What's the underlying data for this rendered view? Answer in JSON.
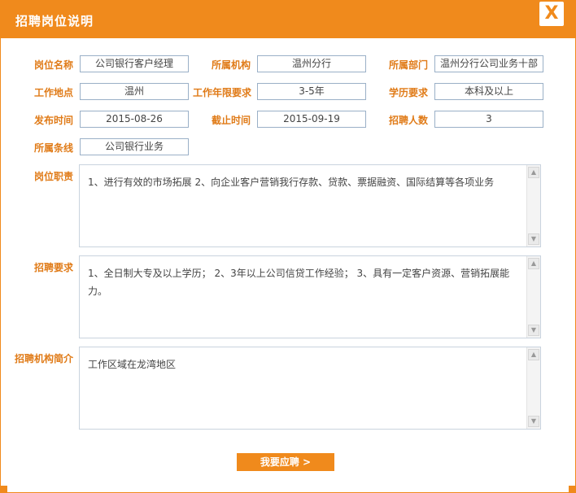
{
  "dialog": {
    "title": "招聘岗位说明",
    "close_label": "X"
  },
  "fields": {
    "post_name": {
      "label": "岗位名称",
      "value": "公司银行客户经理"
    },
    "org": {
      "label": "所属机构",
      "value": "温州分行"
    },
    "dept": {
      "label": "所属部门",
      "value": "温州分行公司业务十部"
    },
    "location": {
      "label": "工作地点",
      "value": "温州"
    },
    "years": {
      "label": "工作年限要求",
      "value": "3-5年"
    },
    "education": {
      "label": "学历要求",
      "value": "本科及以上"
    },
    "publish_date": {
      "label": "发布时间",
      "value": "2015-08-26"
    },
    "deadline": {
      "label": "截止时间",
      "value": "2015-09-19"
    },
    "headcount": {
      "label": "招聘人数",
      "value": "3"
    },
    "line": {
      "label": "所属条线",
      "value": "公司银行业务"
    }
  },
  "duties": {
    "label": "岗位职责",
    "text": "1、进行有效的市场拓展 2、向企业客户营销我行存款、贷款、票据融资、国际结算等各项业务"
  },
  "requirements": {
    "label": "招聘要求",
    "text": "1、全日制大专及以上学历； 2、3年以上公司信贷工作经验； 3、具有一定客户资源、营销拓展能力。"
  },
  "intro": {
    "label": "招聘机构简介",
    "text": "工作区域在龙湾地区"
  },
  "apply_button": {
    "label": "我要应聘 >"
  }
}
